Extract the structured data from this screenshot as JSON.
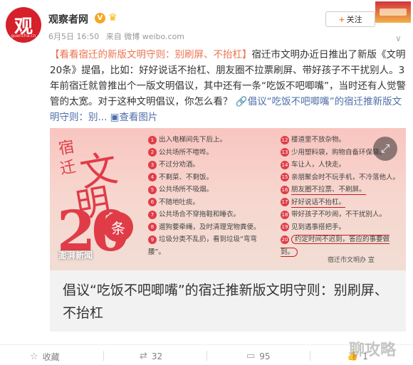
{
  "user": {
    "avatar_text": "观",
    "avatar_tag": "guancha.cn",
    "name": "观察者网",
    "verified_badge": "V",
    "meta_date": "6月5日 16:50",
    "meta_source": "来自 微博 weibo.com"
  },
  "follow": {
    "label": "关注"
  },
  "post": {
    "text_link": "【看看宿迁的新版文明守则：别刷屏、不抬杠】",
    "text_body": "宿迁市文明办近日推出了新版《文明20条》提倡，比如：好好说话不抬杠、朋友圈不拉票刷屏、带好孩子不干扰别人。3年前宿迁就曾推出个一版文明倡议，其中还有一条“吃饭不吧唧嘴”，当时还有人觉警管的太宽。对于这种文明倡议，你怎么看？",
    "article_link": "倡议“吃饭不吧唧嘴”的宿迁推新版文明守则：别...",
    "view_images": "查看图片"
  },
  "card": {
    "photo_title_chars": [
      "宿",
      "迁",
      "文",
      "明",
      "20",
      "条"
    ],
    "photo_source": "澎湃新闻",
    "photo_credit": "宿迁市文明办 宣",
    "rules_left": [
      {
        "n": "1",
        "t": "出入电梯间先下后上。"
      },
      {
        "n": "2",
        "t": "公共场所不喧哗。"
      },
      {
        "n": "3",
        "t": "不过分劝酒。"
      },
      {
        "n": "4",
        "t": "不剩菜、不剩饭。"
      },
      {
        "n": "5",
        "t": "公共场所不吸烟。"
      },
      {
        "n": "6",
        "t": "不随地吐痰。"
      },
      {
        "n": "7",
        "t": "公共场合不穿拖鞋和睡衣。"
      },
      {
        "n": "8",
        "t": "遛狗要牵绳，及时清理宠物粪便。"
      },
      {
        "n": "9",
        "t": "垃圾分类不乱扔，看到垃圾“弯弯腰”。"
      }
    ],
    "rules_right": [
      {
        "n": "12",
        "t": "楼道里不放杂物。"
      },
      {
        "n": "13",
        "t": "少用塑料袋，购物自备环保袋。"
      },
      {
        "n": "14",
        "t": "车让人，人快走。"
      },
      {
        "n": "15",
        "t": "亲朋聚会时不玩手机，不冷落他人。"
      },
      {
        "n": "16",
        "t": "朋友圈不拉票、不刷屏。"
      },
      {
        "n": "17",
        "t": "好好说话不抬杠。"
      },
      {
        "n": "18",
        "t": "带好孩子不吵闹，不干扰别人。"
      },
      {
        "n": "19",
        "t": "见到遇事搭把手。"
      },
      {
        "n": "20",
        "t": "约定时间不迟到，答应的事要做到。"
      }
    ],
    "title": "倡议“吃饭不吧唧嘴”的宿迁推新版文明守则：别刷屏、不抬杠"
  },
  "actions": {
    "collect": "收藏",
    "repost": "32",
    "comment": "95",
    "like": "1"
  },
  "watermark": "聊攻略",
  "colors": {
    "brand_red": "#d6202a",
    "link_orange": "#eb7350",
    "link_blue": "#4e6ea7"
  }
}
